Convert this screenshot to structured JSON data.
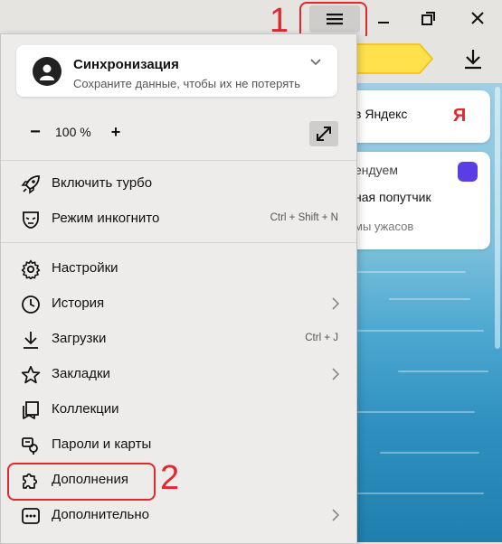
{
  "window": {
    "menu_button_icon": "hamburger-icon",
    "minimize_icon": "minimize-icon",
    "restore_icon": "restore-icon",
    "close_icon": "close-icon",
    "download_icon": "download-icon"
  },
  "callouts": {
    "one": "1",
    "two": "2",
    "color": "#e0282d"
  },
  "background_cards": {
    "card1_text": "в Яндекс",
    "card1_logo": "Я",
    "card2_line1": "ендуем",
    "card2_line2": "ная попутчик",
    "card2_line3": "мы ужасов"
  },
  "menu": {
    "sync": {
      "title": "Синхронизация",
      "subtitle": "Сохраните данные, чтобы их не потерять"
    },
    "zoom": {
      "minus": "−",
      "value": "100 %",
      "plus": "+"
    },
    "items": [
      {
        "label": "Включить турбо",
        "icon": "rocket-icon"
      },
      {
        "label": "Режим инкогнито",
        "icon": "incognito-mask-icon",
        "shortcut": "Ctrl + Shift + N"
      },
      {
        "label": "Настройки",
        "icon": "gear-icon"
      },
      {
        "label": "История",
        "icon": "clock-icon"
      },
      {
        "label": "Загрузки",
        "icon": "download-icon",
        "shortcut": "Ctrl + J"
      },
      {
        "label": "Закладки",
        "icon": "star-icon"
      },
      {
        "label": "Коллекции",
        "icon": "collections-icon"
      },
      {
        "label": "Пароли и карты",
        "icon": "key-icon"
      },
      {
        "label": "Дополнения",
        "icon": "puzzle-icon"
      },
      {
        "label": "Дополнительно",
        "icon": "more-icon"
      }
    ]
  }
}
